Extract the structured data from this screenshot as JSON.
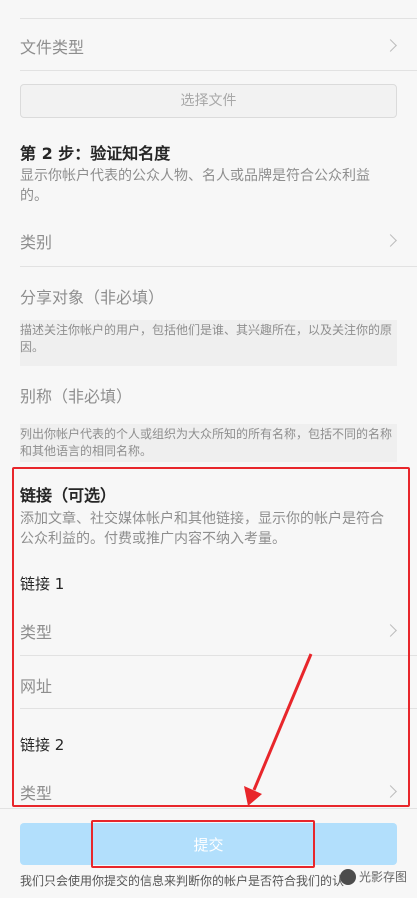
{
  "file_type": {
    "label": "文件类型"
  },
  "select_file": {
    "label": "选择文件"
  },
  "step2": {
    "title": "第 2 步：验证知名度",
    "description": "显示你帐户代表的公众人物、名人或品牌是符合公众利益的。"
  },
  "category": {
    "label": "类别"
  },
  "audience": {
    "label": "分享对象（非必填）",
    "help": "描述关注你帐户的用户，包括他们是谁、其兴趣所在，以及关注你的原因。"
  },
  "alias": {
    "label": "别称（非必填）",
    "help": "列出你帐户代表的个人或组织为大众所知的所有名称，包括不同的名称和其他语言的相同名称。"
  },
  "links": {
    "title": "链接（可选）",
    "description": "添加文章、社交媒体帐户和其他链接，显示你的帐户是符合公众利益的。付费或推广内容不纳入考量。",
    "link1": {
      "title": "链接 1",
      "type_label": "类型",
      "url_label": "网址"
    },
    "link2": {
      "title": "链接 2",
      "type_label": "类型"
    }
  },
  "submit": {
    "label": "提交"
  },
  "footer": {
    "text": "我们只会使用你提交的信息来判断你的帐户是否符合我们的认"
  },
  "watermark": {
    "text": "光影存图"
  },
  "colors": {
    "submit_bg": "#b2dffc",
    "highlight": "#e8262b",
    "muted_text": "#8e8e8e"
  }
}
